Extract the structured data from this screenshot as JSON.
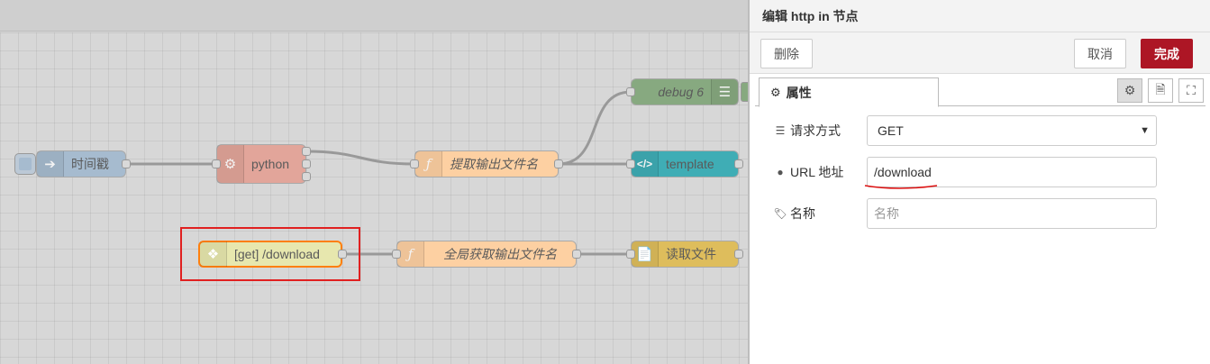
{
  "workspace": {
    "nodes": {
      "timestamp": "时间戳",
      "python": "python",
      "extract_filename": "提取输出文件名",
      "debug": "debug 6",
      "template": "template",
      "http_in": "[get] /download",
      "global_filename": "全局获取输出文件名",
      "read_file": "读取文件"
    }
  },
  "tray": {
    "title": "编辑 http in 节点",
    "buttons": {
      "delete": "删除",
      "cancel": "取消",
      "done": "完成"
    },
    "tabs": {
      "properties": "属性"
    },
    "form": {
      "method_label": "请求方式",
      "method_value": "GET",
      "url_label": "URL 地址",
      "url_value": "/download",
      "name_label": "名称",
      "name_placeholder": "名称"
    }
  },
  "colors": {
    "done_button": "#ad1625",
    "selection_highlight": "#e02020",
    "node_inject": "#a6bbcf",
    "node_python": "#e2a59a",
    "node_function": "#fdd0a2",
    "node_debug": "#87a980",
    "node_template": "#3fadb5",
    "node_http_in": "#e7e7ae",
    "node_file": "#debd5c"
  }
}
